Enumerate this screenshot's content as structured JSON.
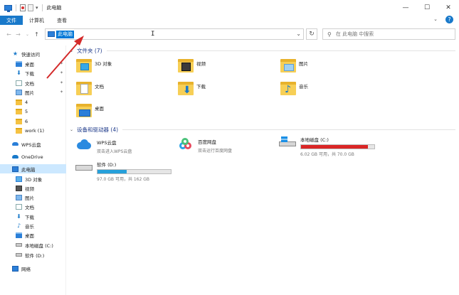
{
  "window": {
    "title": "此电脑",
    "controls": {
      "minimize": "—",
      "maximize": "☐",
      "close": "✕"
    }
  },
  "ribbon": {
    "tabs": [
      {
        "label": "文件",
        "active": true
      },
      {
        "label": "计算机",
        "active": false
      },
      {
        "label": "查看",
        "active": false
      }
    ],
    "help": "?"
  },
  "address": {
    "path": "此电脑",
    "search_placeholder": "在 此电脑 中搜索"
  },
  "sidebar": {
    "items": [
      {
        "label": "快速访问",
        "icon": "star-icon"
      },
      {
        "label": "桌面",
        "icon": "desktop-icon",
        "pinned": true
      },
      {
        "label": "下载",
        "icon": "download-icon",
        "pinned": true
      },
      {
        "label": "文档",
        "icon": "document-icon",
        "pinned": true
      },
      {
        "label": "图片",
        "icon": "picture-icon",
        "pinned": true
      },
      {
        "label": "4",
        "icon": "folder-icon"
      },
      {
        "label": "5",
        "icon": "folder-icon"
      },
      {
        "label": "6",
        "icon": "folder-icon"
      },
      {
        "label": "work (1)",
        "icon": "folder-icon"
      },
      {
        "label": "WPS云盘",
        "icon": "wps-cloud-icon"
      },
      {
        "label": "OneDrive",
        "icon": "onedrive-icon"
      },
      {
        "label": "此电脑",
        "icon": "pc-icon",
        "selected": true
      },
      {
        "label": "3D 对象",
        "icon": "3d-objects-icon"
      },
      {
        "label": "视频",
        "icon": "video-icon"
      },
      {
        "label": "图片",
        "icon": "picture-icon"
      },
      {
        "label": "文档",
        "icon": "document-icon"
      },
      {
        "label": "下载",
        "icon": "download-icon"
      },
      {
        "label": "音乐",
        "icon": "music-icon"
      },
      {
        "label": "桌面",
        "icon": "desktop-icon"
      },
      {
        "label": "本地磁盘 (C:)",
        "icon": "drive-icon"
      },
      {
        "label": "软件 (D:)",
        "icon": "drive-icon"
      },
      {
        "label": "网络",
        "icon": "network-icon"
      }
    ]
  },
  "folders": {
    "header": "文件夹 (7)",
    "items": [
      {
        "label": "3D 对象",
        "icon": "3d-objects-folder-icon"
      },
      {
        "label": "视频",
        "icon": "video-folder-icon"
      },
      {
        "label": "图片",
        "icon": "picture-folder-icon"
      },
      {
        "label": "文档",
        "icon": "document-folder-icon"
      },
      {
        "label": "下载",
        "icon": "download-folder-icon"
      },
      {
        "label": "音乐",
        "icon": "music-folder-icon"
      },
      {
        "label": "桌面",
        "icon": "desktop-folder-icon"
      }
    ]
  },
  "devices": {
    "header": "设备和驱动器 (4)",
    "items": [
      {
        "name": "WPS云盘",
        "sub": "双击进入WPS云盘",
        "icon": "wps-cloud-icon"
      },
      {
        "name": "百度网盘",
        "sub": "双击运行百度网盘",
        "icon": "baidu-netdisk-icon"
      },
      {
        "name": "本地磁盘 (C:)",
        "sub": "6.02 GB 可用，共 70.0 GB",
        "icon": "windows-drive-icon",
        "used_fraction": 0.914,
        "bar_color": "#da2626"
      },
      {
        "name": "软件 (D:)",
        "sub": "97.0 GB 可用，共 162 GB",
        "icon": "drive-icon",
        "used_fraction": 0.401,
        "bar_color": "#26a0da"
      }
    ]
  }
}
